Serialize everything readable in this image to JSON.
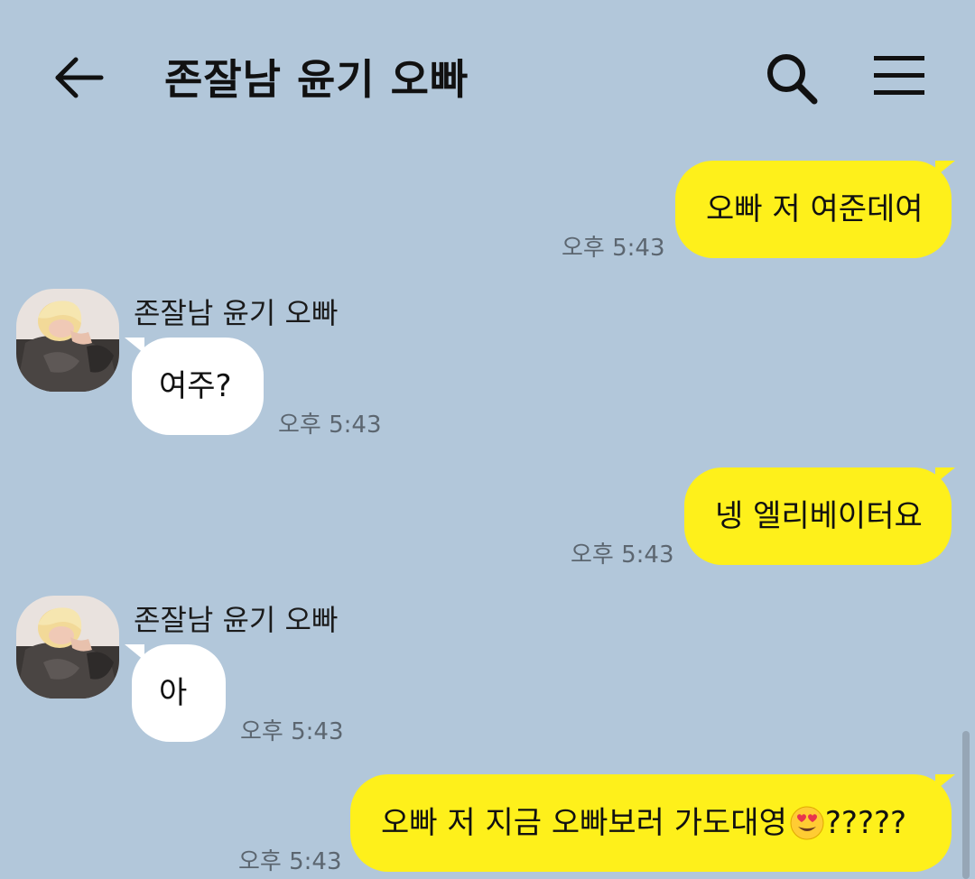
{
  "header": {
    "title": "존잘남 윤기 오빠",
    "back_icon": "arrow-left-icon",
    "search_icon": "search-icon",
    "menu_icon": "hamburger-menu-icon"
  },
  "colors": {
    "background": "#b2c7da",
    "my_bubble": "#fef01b",
    "their_bubble": "#ffffff"
  },
  "messages": [
    {
      "from": "me",
      "text": "오빠 저 여준데여",
      "time": "오후 5:43"
    },
    {
      "from": "them",
      "sender": "존잘남 윤기 오빠",
      "text": "여주?",
      "time": "오후 5:43"
    },
    {
      "from": "me",
      "text": "넹 엘리베이터요",
      "time": "오후 5:43"
    },
    {
      "from": "them",
      "sender": "존잘남 윤기 오빠",
      "text": "아",
      "time": "오후 5:43"
    },
    {
      "from": "me",
      "text": "오빠 저 지금 오빠보러 가도대영",
      "emoji": "heart-eyes-emoji",
      "text_after": "?????",
      "time": "오후 5:43"
    }
  ]
}
